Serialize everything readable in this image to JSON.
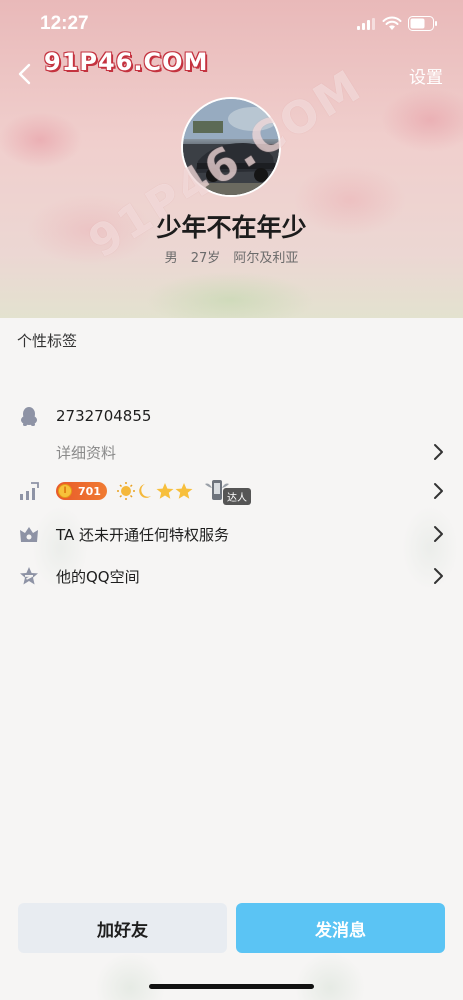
{
  "status_bar": {
    "time": "12:27"
  },
  "header": {
    "watermark": "91P46.COM",
    "settings_label": "设置"
  },
  "profile": {
    "nickname": "少年不在年少",
    "gender": "男",
    "age": "27岁",
    "location": "阿尔及利亚",
    "diagonal_watermark": "91P46.COM"
  },
  "sections": {
    "signature_label": "个性标签"
  },
  "rows": {
    "qq_number": "2732704855",
    "details_label": "详细资料",
    "level_value": "701",
    "daren_label": "达人",
    "privilege_text": "TA 还未开通任何特权服务",
    "qzone_text": "他的QQ空间"
  },
  "actions": {
    "add_friend": "加好友",
    "send_message": "发消息"
  },
  "colors": {
    "primary_button": "#5bc4f4",
    "secondary_button": "#e8ecf1",
    "level_pill": "#e85a2a"
  }
}
